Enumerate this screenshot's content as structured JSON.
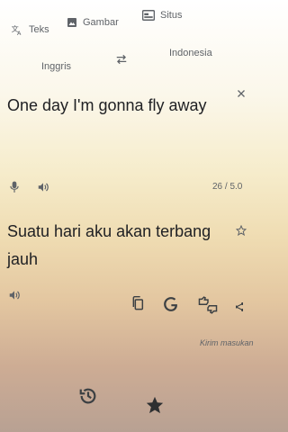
{
  "tabs": [
    {
      "label": "Teks",
      "icon": "translate-icon"
    },
    {
      "label": "Gambar",
      "icon": "image-icon"
    },
    {
      "label": "Situs",
      "icon": "website-icon"
    }
  ],
  "languages": {
    "source": "Inggris",
    "target": "Indonesia",
    "swap_icon": "swap-icon"
  },
  "source": {
    "text": "One day I'm gonna fly away",
    "counter": "26 / 5.0",
    "icons": [
      "microphone-icon",
      "speaker-icon",
      "clear-icon"
    ]
  },
  "target": {
    "text": "Suatu hari aku akan terbang jauh",
    "icons": [
      "speaker-icon",
      "copy-icon",
      "google-icon",
      "feedback-icon",
      "share-icon",
      "star-icon"
    ]
  },
  "feedback_text": "Kirim masukan",
  "bottom_nav": {
    "icons": [
      "history-icon",
      "saved-star-icon"
    ]
  },
  "colors": {
    "text": "#202124",
    "muted": "#5f6368"
  }
}
